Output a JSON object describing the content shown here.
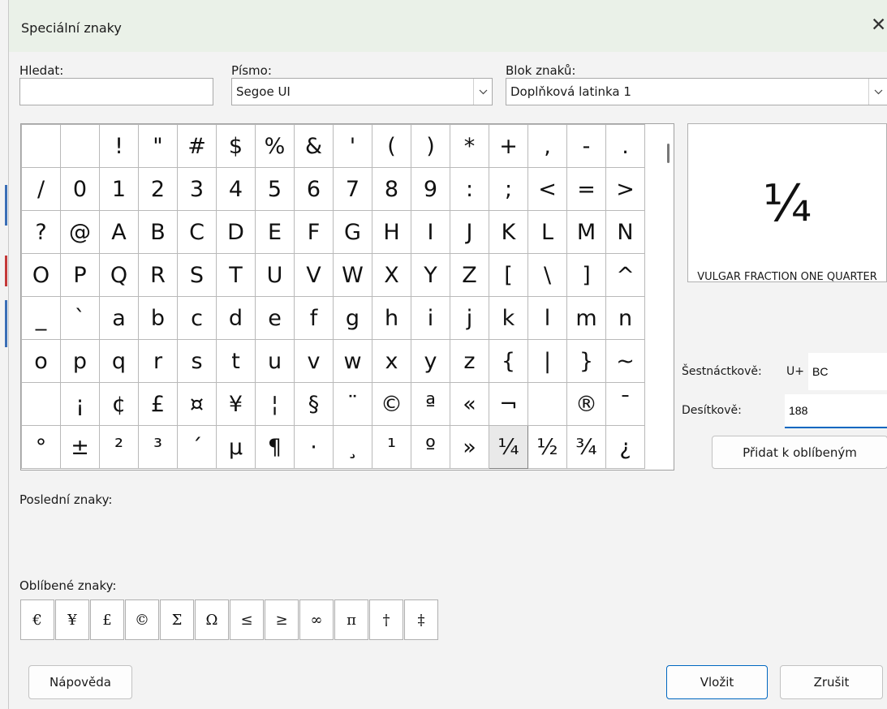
{
  "window": {
    "title": "Speciální znaky",
    "close_glyph": "✕"
  },
  "search": {
    "label": "Hledat:",
    "value": ""
  },
  "font": {
    "label": "Písmo:",
    "value": "Segoe UI"
  },
  "block": {
    "label": "Blok znaků:",
    "value": "Doplňková latinka 1"
  },
  "char_grid": {
    "rows": [
      [
        " ",
        " ",
        "!",
        "\"",
        "#",
        "$",
        "%",
        "&",
        "'",
        "(",
        ")",
        "*",
        "+",
        ",",
        "-",
        "."
      ],
      [
        "/",
        "0",
        "1",
        "2",
        "3",
        "4",
        "5",
        "6",
        "7",
        "8",
        "9",
        ":",
        ";",
        "<",
        "=",
        ">"
      ],
      [
        "?",
        "@",
        "A",
        "B",
        "C",
        "D",
        "E",
        "F",
        "G",
        "H",
        "I",
        "J",
        "K",
        "L",
        "M",
        "N"
      ],
      [
        "O",
        "P",
        "Q",
        "R",
        "S",
        "T",
        "U",
        "V",
        "W",
        "X",
        "Y",
        "Z",
        "[",
        "\\",
        "]",
        "^"
      ],
      [
        "_",
        "`",
        "a",
        "b",
        "c",
        "d",
        "e",
        "f",
        "g",
        "h",
        "i",
        "j",
        "k",
        "l",
        "m",
        "n"
      ],
      [
        "o",
        "p",
        "q",
        "r",
        "s",
        "t",
        "u",
        "v",
        "w",
        "x",
        "y",
        "z",
        "{",
        "|",
        "}",
        "~"
      ],
      [
        " ",
        "¡",
        "¢",
        "£",
        "¤",
        "¥",
        "¦",
        "§",
        "¨",
        "©",
        "ª",
        "«",
        "¬",
        " ",
        "®",
        "¯"
      ],
      [
        "°",
        "±",
        "²",
        "³",
        "´",
        "µ",
        "¶",
        "·",
        "¸",
        "¹",
        "º",
        "»",
        "¼",
        "½",
        "¾",
        "¿"
      ]
    ],
    "selected": {
      "row": 7,
      "col": 12
    }
  },
  "preview": {
    "char": "¼",
    "name": "VULGAR FRACTION ONE QUARTER"
  },
  "hex": {
    "label": "Šestnáctkově:",
    "prefix": "U+",
    "value": "BC"
  },
  "decimal": {
    "label": "Desítkově:",
    "value": "188"
  },
  "buttons": {
    "add_favorite": "Přidat k oblíbeným",
    "help": "Nápověda",
    "insert": "Vložit",
    "cancel": "Zrušit"
  },
  "recent": {
    "label": "Poslední znaky:"
  },
  "favorites": {
    "label": "Oblíbené znaky:",
    "chars": [
      "€",
      "¥",
      "£",
      "©",
      "Σ",
      "Ω",
      "≤",
      "≥",
      "∞",
      "π",
      "†",
      "‡"
    ]
  },
  "colors": {
    "accent": "#0067c0",
    "titlebar": "#eaf1e8"
  }
}
